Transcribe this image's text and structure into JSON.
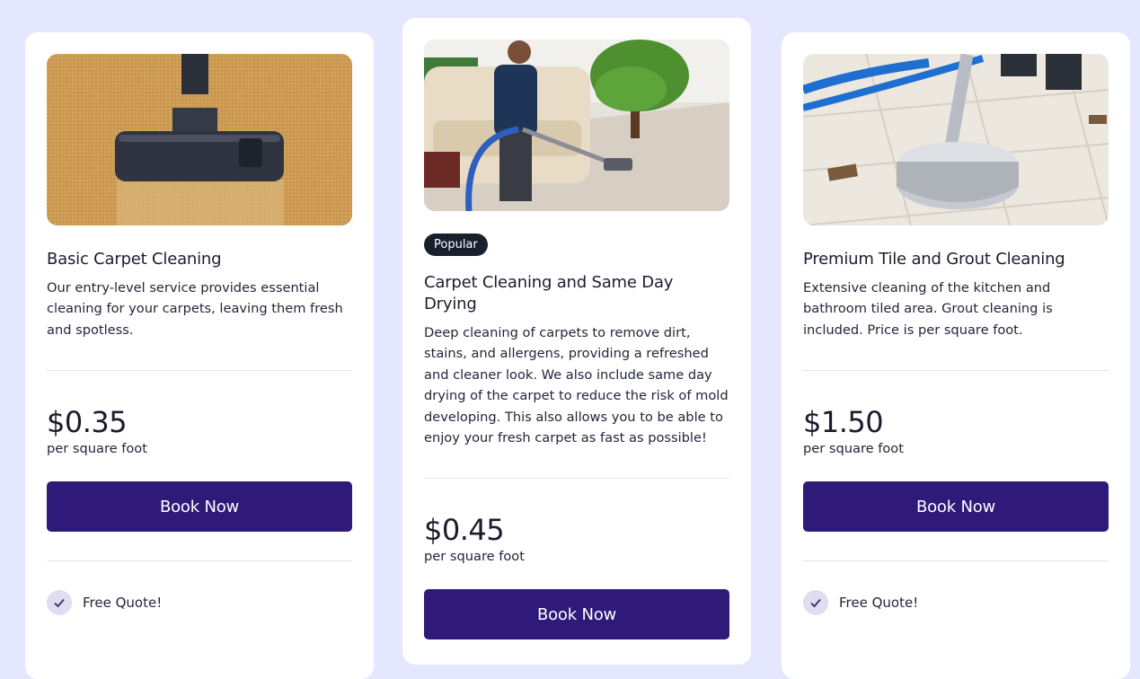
{
  "cards": [
    {
      "image_alt": "carpet-vacuum-photo",
      "title": "Basic Carpet Cleaning",
      "description": "Our entry-level service provides essential cleaning for your carpets, leaving them fresh and spotless.",
      "price": "$0.35",
      "unit": "per square foot",
      "button": "Book Now",
      "features": [
        "Free Quote!"
      ]
    },
    {
      "image_alt": "man-cleaning-carpet-photo",
      "badge": "Popular",
      "title": "Carpet Cleaning and Same Day Drying",
      "description": "Deep cleaning of carpets to remove dirt, stains, and allergens, providing a refreshed and cleaner look. We also include same day drying of the carpet to reduce the risk of mold developing. This also allows you to be able to enjoy your fresh carpet as fast as possible!",
      "price": "$0.45",
      "unit": "per square foot",
      "button": "Book Now",
      "features": []
    },
    {
      "image_alt": "tile-floor-cleaner-photo",
      "title": "Premium Tile and Grout Cleaning",
      "description": "Extensive cleaning of the kitchen and bathroom tiled area. Grout cleaning is included. Price is per square foot.",
      "price": "$1.50",
      "unit": "per square foot",
      "button": "Book Now",
      "features": [
        "Free Quote!"
      ]
    }
  ],
  "colors": {
    "page_bg": "#e4e7fd",
    "button_bg": "#2f1a7a",
    "badge_bg": "#1a1f2e",
    "check_bg": "#e1dcef"
  }
}
